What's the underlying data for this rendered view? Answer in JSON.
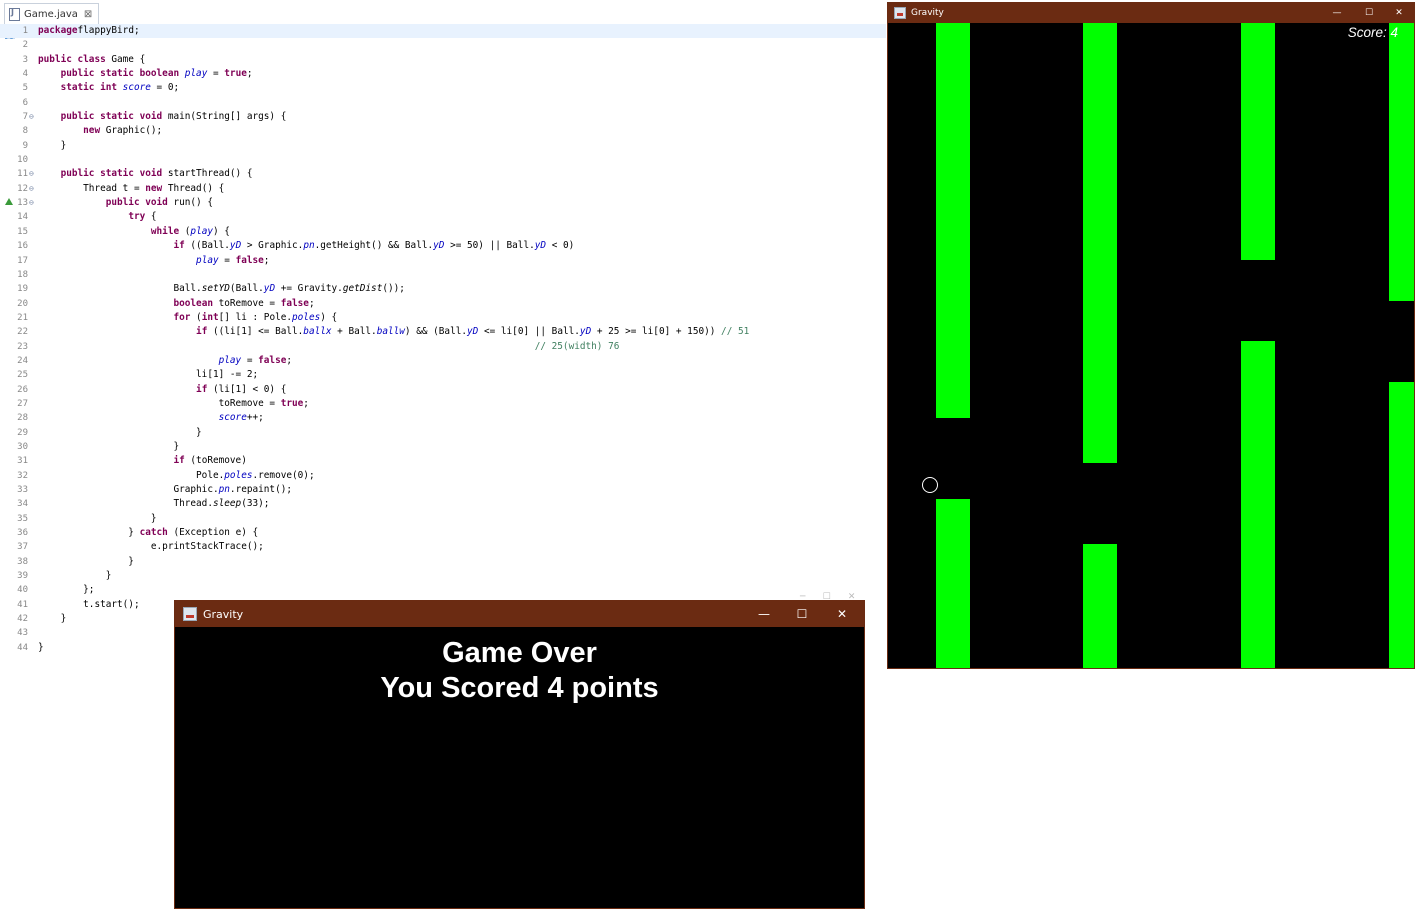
{
  "editor": {
    "tab_label": "Game.java",
    "lines": [
      {
        "n": "1",
        "g": "",
        "hl": true,
        "t": [
          [
            "k",
            "package"
          ],
          [
            "",
            "flappyBird;"
          ]
        ]
      },
      {
        "n": "2",
        "g": "",
        "t": []
      },
      {
        "n": "3",
        "g": "",
        "t": [
          [
            "k",
            "public class "
          ],
          [
            "",
            "Game {"
          ]
        ]
      },
      {
        "n": "4",
        "g": "",
        "t": [
          [
            "",
            "    "
          ],
          [
            "k",
            "public static boolean "
          ],
          [
            "fs",
            "play"
          ],
          [
            "",
            " = "
          ],
          [
            "k",
            "true"
          ],
          [
            "",
            ";"
          ]
        ]
      },
      {
        "n": "5",
        "g": "",
        "t": [
          [
            "",
            "    "
          ],
          [
            "k",
            "static int "
          ],
          [
            "fs",
            "score"
          ],
          [
            "",
            " = 0;"
          ]
        ]
      },
      {
        "n": "6",
        "g": "",
        "t": []
      },
      {
        "n": "7",
        "g": "⊖",
        "t": [
          [
            "",
            "    "
          ],
          [
            "k",
            "public static void "
          ],
          [
            "",
            "main(String[] args) {"
          ]
        ]
      },
      {
        "n": "8",
        "g": "",
        "t": [
          [
            "",
            "        "
          ],
          [
            "k",
            "new "
          ],
          [
            "",
            "Graphic();"
          ]
        ]
      },
      {
        "n": "9",
        "g": "",
        "t": [
          [
            "",
            "    }"
          ]
        ]
      },
      {
        "n": "10",
        "g": "",
        "t": []
      },
      {
        "n": "11",
        "g": "⊖",
        "t": [
          [
            "",
            "    "
          ],
          [
            "k",
            "public static void "
          ],
          [
            "",
            "startThread() {"
          ]
        ]
      },
      {
        "n": "12",
        "g": "⊖",
        "t": [
          [
            "",
            "        Thread t = "
          ],
          [
            "k",
            "new "
          ],
          [
            "",
            "Thread() {"
          ]
        ]
      },
      {
        "n": "13",
        "g": "⊖",
        "t": [
          [
            "",
            "            "
          ],
          [
            "k",
            "public void "
          ],
          [
            "",
            "run() {"
          ]
        ]
      },
      {
        "n": "14",
        "g": "",
        "t": [
          [
            "",
            "                "
          ],
          [
            "k",
            "try "
          ],
          [
            "",
            "{"
          ]
        ]
      },
      {
        "n": "15",
        "g": "",
        "t": [
          [
            "",
            "                    "
          ],
          [
            "k",
            "while "
          ],
          [
            "",
            "("
          ],
          [
            "fs",
            "play"
          ],
          [
            "",
            ") {"
          ]
        ]
      },
      {
        "n": "16",
        "g": "",
        "t": [
          [
            "",
            "                        "
          ],
          [
            "k",
            "if "
          ],
          [
            "",
            "((Ball."
          ],
          [
            "fs",
            "yD"
          ],
          [
            "",
            " > Graphic."
          ],
          [
            "fs",
            "pn"
          ],
          [
            "",
            ".getHeight() && Ball."
          ],
          [
            "fs",
            "yD"
          ],
          [
            "",
            " >= 50) || Ball."
          ],
          [
            "fs",
            "yD"
          ],
          [
            "",
            " < 0)"
          ]
        ]
      },
      {
        "n": "17",
        "g": "",
        "t": [
          [
            "",
            "                            "
          ],
          [
            "fs",
            "play"
          ],
          [
            "",
            " = "
          ],
          [
            "k",
            "false"
          ],
          [
            "",
            ";"
          ]
        ]
      },
      {
        "n": "18",
        "g": "",
        "t": []
      },
      {
        "n": "19",
        "g": "",
        "t": [
          [
            "",
            "                        Ball."
          ],
          [
            "st",
            "setYD"
          ],
          [
            "",
            "(Ball."
          ],
          [
            "fs",
            "yD"
          ],
          [
            "",
            " += Gravity."
          ],
          [
            "st",
            "getDist"
          ],
          [
            "",
            "());"
          ]
        ]
      },
      {
        "n": "20",
        "g": "",
        "t": [
          [
            "",
            "                        "
          ],
          [
            "k",
            "boolean "
          ],
          [
            "",
            "toRemove = "
          ],
          [
            "k",
            "false"
          ],
          [
            "",
            ";"
          ]
        ]
      },
      {
        "n": "21",
        "g": "",
        "t": [
          [
            "",
            "                        "
          ],
          [
            "k",
            "for "
          ],
          [
            "",
            "("
          ],
          [
            "k",
            "int"
          ],
          [
            "",
            "[] li : Pole."
          ],
          [
            "fs",
            "poles"
          ],
          [
            "",
            ") {"
          ]
        ]
      },
      {
        "n": "22",
        "g": "",
        "t": [
          [
            "",
            "                            "
          ],
          [
            "k",
            "if "
          ],
          [
            "",
            "((li[1] <= Ball."
          ],
          [
            "fs",
            "ballx"
          ],
          [
            "",
            " + Ball."
          ],
          [
            "fs",
            "ballw"
          ],
          [
            "",
            ") && (Ball."
          ],
          [
            "fs",
            "yD"
          ],
          [
            "",
            " <= li[0] || Ball."
          ],
          [
            "fs",
            "yD"
          ],
          [
            "",
            " + 25 >= li[0] + 150)) "
          ],
          [
            "cm",
            "// 51"
          ]
        ]
      },
      {
        "n": "23",
        "g": "",
        "t": [
          [
            "",
            "                                                                                        "
          ],
          [
            "cm",
            "// 25(width) 76"
          ]
        ]
      },
      {
        "n": "24",
        "g": "",
        "t": [
          [
            "",
            "                                "
          ],
          [
            "fs",
            "play"
          ],
          [
            "",
            " = "
          ],
          [
            "k",
            "false"
          ],
          [
            "",
            ";"
          ]
        ]
      },
      {
        "n": "25",
        "g": "",
        "t": [
          [
            "",
            "                            li[1] -= 2;"
          ]
        ]
      },
      {
        "n": "26",
        "g": "",
        "t": [
          [
            "",
            "                            "
          ],
          [
            "k",
            "if "
          ],
          [
            "",
            "(li[1] < 0) {"
          ]
        ]
      },
      {
        "n": "27",
        "g": "",
        "t": [
          [
            "",
            "                                toRemove = "
          ],
          [
            "k",
            "true"
          ],
          [
            "",
            ";"
          ]
        ]
      },
      {
        "n": "28",
        "g": "",
        "t": [
          [
            "",
            "                                "
          ],
          [
            "fs",
            "score"
          ],
          [
            "",
            "++;"
          ]
        ]
      },
      {
        "n": "29",
        "g": "",
        "t": [
          [
            "",
            "                            }"
          ]
        ]
      },
      {
        "n": "30",
        "g": "",
        "t": [
          [
            "",
            "                        }"
          ]
        ]
      },
      {
        "n": "31",
        "g": "",
        "t": [
          [
            "",
            "                        "
          ],
          [
            "k",
            "if "
          ],
          [
            "",
            "(toRemove)"
          ]
        ]
      },
      {
        "n": "32",
        "g": "",
        "t": [
          [
            "",
            "                            Pole."
          ],
          [
            "fs",
            "poles"
          ],
          [
            "",
            ".remove(0);"
          ]
        ]
      },
      {
        "n": "33",
        "g": "",
        "t": [
          [
            "",
            "                        Graphic."
          ],
          [
            "fs",
            "pn"
          ],
          [
            "",
            ".repaint();"
          ]
        ]
      },
      {
        "n": "34",
        "g": "",
        "t": [
          [
            "",
            "                        Thread."
          ],
          [
            "st",
            "sleep"
          ],
          [
            "",
            "(33);"
          ]
        ]
      },
      {
        "n": "35",
        "g": "",
        "t": [
          [
            "",
            "                    }"
          ]
        ]
      },
      {
        "n": "36",
        "g": "",
        "t": [
          [
            "",
            "                } "
          ],
          [
            "k",
            "catch "
          ],
          [
            "",
            "(Exception e) {"
          ]
        ]
      },
      {
        "n": "37",
        "g": "",
        "t": [
          [
            "",
            "                    e.printStackTrace();"
          ]
        ]
      },
      {
        "n": "38",
        "g": "",
        "t": [
          [
            "",
            "                }"
          ]
        ]
      },
      {
        "n": "39",
        "g": "",
        "t": [
          [
            "",
            "            }"
          ]
        ]
      },
      {
        "n": "40",
        "g": "",
        "t": [
          [
            "",
            "        };"
          ]
        ]
      },
      {
        "n": "41",
        "g": "",
        "t": [
          [
            "",
            "        t.start();"
          ]
        ]
      },
      {
        "n": "42",
        "g": "",
        "t": [
          [
            "",
            "    }"
          ]
        ]
      },
      {
        "n": "43",
        "g": "",
        "t": []
      },
      {
        "n": "44",
        "g": "",
        "t": [
          [
            "",
            "}"
          ]
        ]
      }
    ]
  },
  "game_over_window": {
    "title": "Gravity",
    "minimize": "—",
    "maximize": "☐",
    "close": "✕",
    "line1": "Game Over",
    "line2": "You Scored 4 points"
  },
  "game_window": {
    "title": "Gravity",
    "minimize": "—",
    "maximize": "☐",
    "close": "✕",
    "score_text": "Score: 4",
    "pole_color": "#00ff00"
  },
  "colors": {
    "titlebar": "#6b2b12",
    "keyword": "#7f0055",
    "field": "#0000c0",
    "comment": "#3f7f5f"
  }
}
